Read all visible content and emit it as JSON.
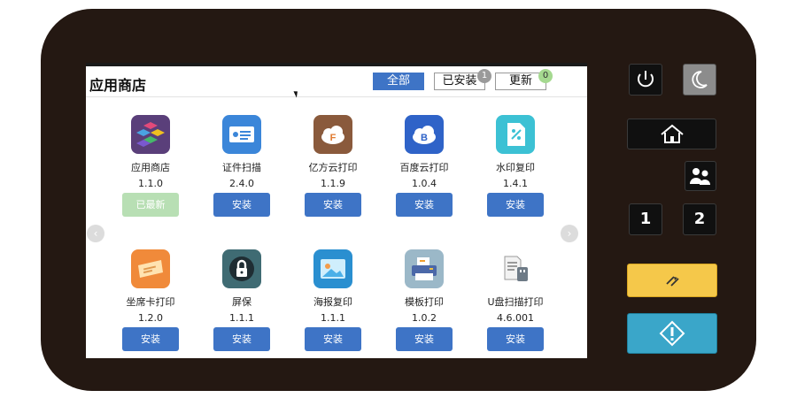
{
  "header": {
    "title": "应用商店",
    "tabs": [
      {
        "label": "全部",
        "active": true
      },
      {
        "label": "已安装",
        "active": false,
        "badge": "1"
      },
      {
        "label": "更新",
        "active": false,
        "badge": "0"
      }
    ]
  },
  "apps": [
    {
      "name": "应用商店",
      "version": "1.1.0",
      "action": "已最新",
      "icon": "app-store-icon"
    },
    {
      "name": "证件扫描",
      "version": "2.4.0",
      "action": "安装",
      "icon": "id-card-scan-icon"
    },
    {
      "name": "亿方云打印",
      "version": "1.1.9",
      "action": "安装",
      "icon": "cloud-print-icon"
    },
    {
      "name": "百度云打印",
      "version": "1.0.4",
      "action": "安装",
      "icon": "baidu-cloud-icon"
    },
    {
      "name": "水印复印",
      "version": "1.4.1",
      "action": "安装",
      "icon": "watermark-copy-icon"
    },
    {
      "name": "坐席卡打印",
      "version": "1.2.0",
      "action": "安装",
      "icon": "seat-card-print-icon"
    },
    {
      "name": "屏保",
      "version": "1.1.1",
      "action": "安装",
      "icon": "lock-icon"
    },
    {
      "name": "海报复印",
      "version": "1.1.1",
      "action": "安装",
      "icon": "poster-copy-icon"
    },
    {
      "name": "模板打印",
      "version": "1.0.2",
      "action": "安装",
      "icon": "template-print-icon"
    },
    {
      "name": "U盘扫描打印",
      "version": "4.6.001",
      "action": "安装",
      "icon": "usb-scan-print-icon"
    }
  ],
  "hardware": {
    "buttons": [
      "power-icon",
      "sleep-icon",
      "home-icon",
      "user-switch-icon",
      "1",
      "2",
      "reset-icon",
      "start-icon"
    ]
  },
  "colors": {
    "accent": "#3e74c6",
    "done": "#b8dfb4",
    "device": "#241812",
    "reset": "#f5c84a",
    "start": "#3aa6c9"
  }
}
